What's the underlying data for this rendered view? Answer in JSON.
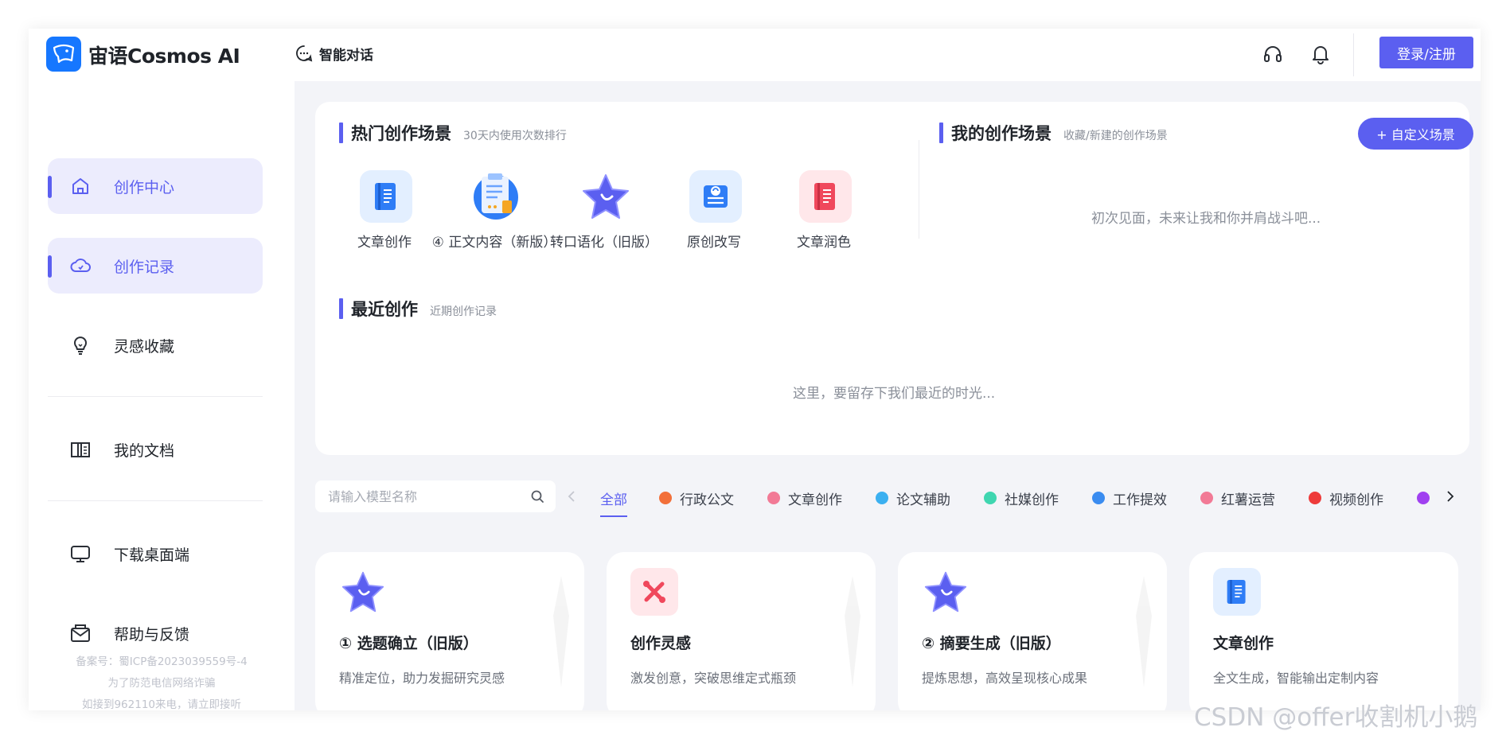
{
  "header": {
    "brand": "宙语Cosmos AI",
    "nav_chat": "智能对话",
    "login_label": "登录/注册"
  },
  "sidebar": {
    "items": [
      {
        "label": "创作中心"
      },
      {
        "label": "创作记录"
      },
      {
        "label": "灵感收藏"
      },
      {
        "label": "我的文档"
      },
      {
        "label": "下载桌面端"
      },
      {
        "label": "帮助与反馈"
      }
    ],
    "footer": [
      "备案号：蜀ICP备2023039559号-4",
      "为了防范电信网络诈骗",
      "如接到962110来电，请立即接听"
    ]
  },
  "hot": {
    "title": "热门创作场景",
    "subtitle": "30天内使用次数排行",
    "items": [
      {
        "label": "文章创作"
      },
      {
        "label": "④ 正文内容（新版）"
      },
      {
        "label": "转口语化（旧版）"
      },
      {
        "label": "原创改写"
      },
      {
        "label": "文章润色"
      }
    ]
  },
  "mine": {
    "title": "我的创作场景",
    "subtitle": "收藏/新建的创作场景",
    "custom_btn": "+ 自定义场景",
    "empty": "初次见面，未来让我和你并肩战斗吧..."
  },
  "recent": {
    "title": "最近创作",
    "subtitle": "近期创作记录",
    "empty": "这里，要留存下我们最近的时光..."
  },
  "filter": {
    "search_placeholder": "请输入模型名称",
    "tabs": [
      {
        "label": "全部",
        "color": ""
      },
      {
        "label": "行政公文",
        "color": "#f2703a"
      },
      {
        "label": "文章创作",
        "color": "#f27a96"
      },
      {
        "label": "论文辅助",
        "color": "#3bb0f0"
      },
      {
        "label": "社媒创作",
        "color": "#3fd6b0"
      },
      {
        "label": "工作提效",
        "color": "#3a8cf0"
      },
      {
        "label": "红薯运营",
        "color": "#f27a96"
      },
      {
        "label": "视频创作",
        "color": "#ee3b3b"
      },
      {
        "label": "",
        "color": "#a040f0"
      }
    ]
  },
  "cards": [
    {
      "title": "① 选题确立（旧版）",
      "desc": "精准定位，助力发掘研究灵感",
      "icon": "star-icon"
    },
    {
      "title": "创作灵感",
      "desc": "激发创意，突破思维定式瓶颈",
      "icon": "tools-icon"
    },
    {
      "title": "② 摘要生成（旧版）",
      "desc": "提炼思想，高效呈现核心成果",
      "icon": "star-icon"
    },
    {
      "title": "文章创作",
      "desc": "全文生成，智能输出定制内容",
      "icon": "notebook-icon"
    }
  ],
  "watermark": "CSDN @offer收割机小鹅",
  "colors": {
    "accent": "#5b5ff0",
    "logo": "#1677ff",
    "background": "#f3f4f8"
  }
}
